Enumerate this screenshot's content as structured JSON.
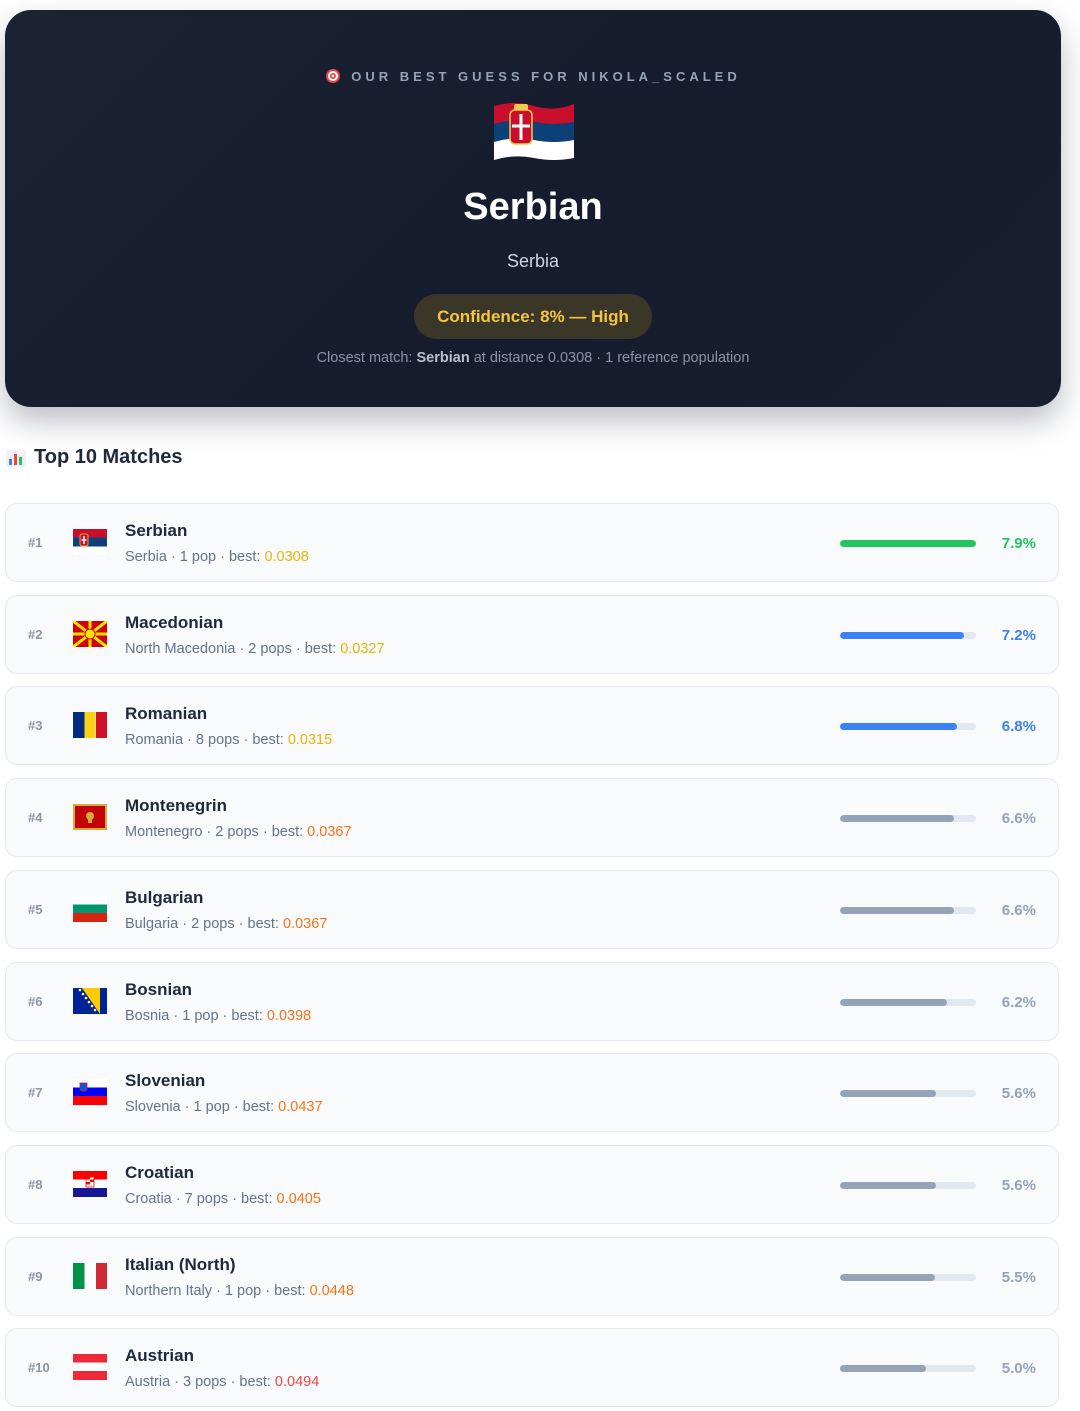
{
  "hero": {
    "label": "OUR BEST GUESS FOR NIKOLA_SCALED",
    "title": "Serbian",
    "country": "Serbia",
    "confidence": "Confidence: 8% — High",
    "closest_prefix": "Closest match:",
    "closest_name": "Serbian",
    "closest_suffix": "at distance 0.0308 · 1 reference population",
    "target_icon": "target-icon",
    "flag_icon": "serbia-flag-icon"
  },
  "section": {
    "title": "Top 10 Matches",
    "icon": "bar-chart-icon"
  },
  "colors": {
    "top": "#22c55e",
    "high": "#3b82f6",
    "rest": "#94a3b8",
    "confidence": "#f5c542"
  },
  "matches": [
    {
      "rank": "#1",
      "name": "Serbian",
      "meta": "Serbia · 1 pop · best:",
      "best": "0.0308",
      "best_color": "#eab308",
      "pct": "7.9%",
      "value": 7.9,
      "bar_color": "#22c55e",
      "pct_color": "#22c55e",
      "flag": "serbia"
    },
    {
      "rank": "#2",
      "name": "Macedonian",
      "meta": "North Macedonia · 2 pops · best:",
      "best": "0.0327",
      "best_color": "#eab308",
      "pct": "7.2%",
      "value": 7.2,
      "bar_color": "#3b82f6",
      "pct_color": "#3b82f6",
      "flag": "north-macedonia"
    },
    {
      "rank": "#3",
      "name": "Romanian",
      "meta": "Romania · 8 pops · best:",
      "best": "0.0315",
      "best_color": "#eab308",
      "pct": "6.8%",
      "value": 6.8,
      "bar_color": "#3b82f6",
      "pct_color": "#3b82f6",
      "flag": "romania"
    },
    {
      "rank": "#4",
      "name": "Montenegrin",
      "meta": "Montenegro · 2 pops · best:",
      "best": "0.0367",
      "best_color": "#f97316",
      "pct": "6.6%",
      "value": 6.6,
      "bar_color": "#94a3b8",
      "pct_color": "#94a3b8",
      "flag": "montenegro"
    },
    {
      "rank": "#5",
      "name": "Bulgarian",
      "meta": "Bulgaria · 2 pops · best:",
      "best": "0.0367",
      "best_color": "#f97316",
      "pct": "6.6%",
      "value": 6.6,
      "bar_color": "#94a3b8",
      "pct_color": "#94a3b8",
      "flag": "bulgaria"
    },
    {
      "rank": "#6",
      "name": "Bosnian",
      "meta": "Bosnia · 1 pop · best:",
      "best": "0.0398",
      "best_color": "#f97316",
      "pct": "6.2%",
      "value": 6.2,
      "bar_color": "#94a3b8",
      "pct_color": "#94a3b8",
      "flag": "bosnia"
    },
    {
      "rank": "#7",
      "name": "Slovenian",
      "meta": "Slovenia · 1 pop · best:",
      "best": "0.0437",
      "best_color": "#f97316",
      "pct": "5.6%",
      "value": 5.6,
      "bar_color": "#94a3b8",
      "pct_color": "#94a3b8",
      "flag": "slovenia"
    },
    {
      "rank": "#8",
      "name": "Croatian",
      "meta": "Croatia · 7 pops · best:",
      "best": "0.0405",
      "best_color": "#f97316",
      "pct": "5.6%",
      "value": 5.6,
      "bar_color": "#94a3b8",
      "pct_color": "#94a3b8",
      "flag": "croatia"
    },
    {
      "rank": "#9",
      "name": "Italian (North)",
      "meta": "Northern Italy · 1 pop · best:",
      "best": "0.0448",
      "best_color": "#f97316",
      "pct": "5.5%",
      "value": 5.5,
      "bar_color": "#94a3b8",
      "pct_color": "#94a3b8",
      "flag": "italy"
    },
    {
      "rank": "#10",
      "name": "Austrian",
      "meta": "Austria · 3 pops · best:",
      "best": "0.0494",
      "best_color": "#ef4444",
      "pct": "5.0%",
      "value": 5.0,
      "bar_color": "#94a3b8",
      "pct_color": "#94a3b8",
      "flag": "austria"
    }
  ]
}
